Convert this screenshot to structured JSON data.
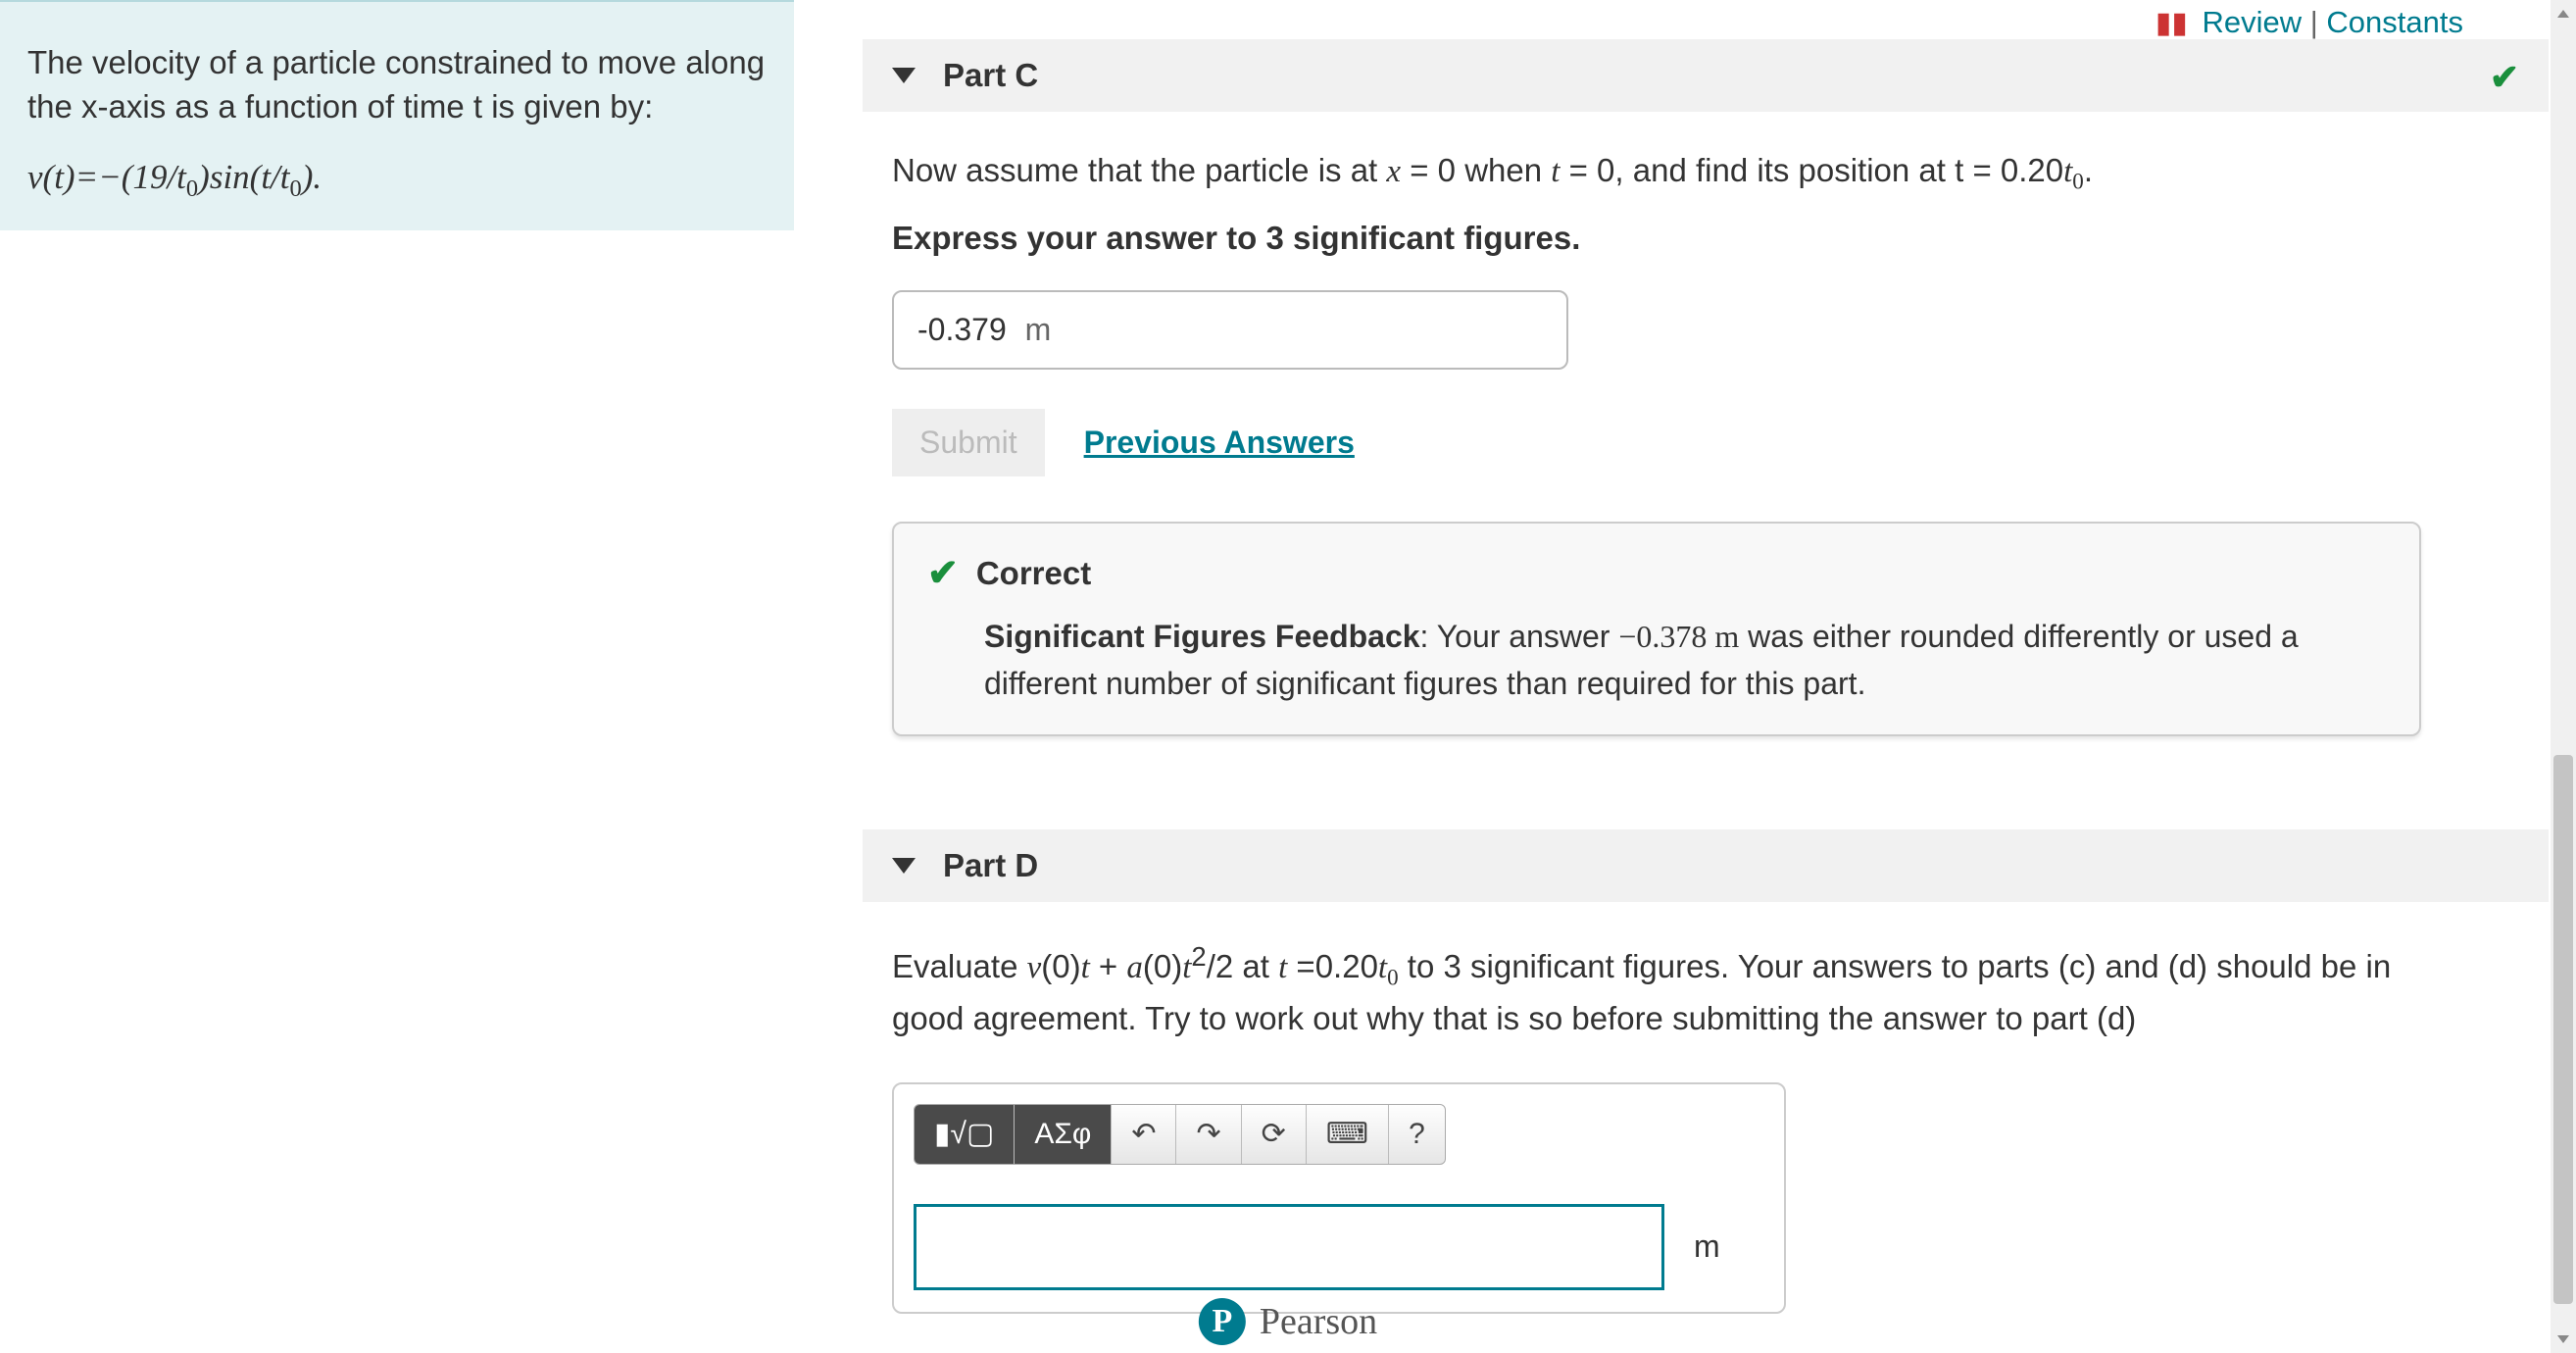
{
  "problem": {
    "intro": "The velocity of a particle constrained to move along the x-axis as a function of time t is given by:",
    "equation_html": "v(t)=−(19/t<sub class='sub'>0</sub>)sin(t/t<sub class='sub'>0</sub>)."
  },
  "toplinks": {
    "review": "Review",
    "constants": "Constants",
    "sep": " | "
  },
  "partC": {
    "title": "Part C",
    "prompt_html": "Now assume that the particle is at <span class='math'>x</span> = 0 when <span class='math'>t</span> = 0, and find its position at t = 0.20<span class='math'>t<sub class='sub'>0</sub></span>.",
    "instruct": "Express your answer to 3 significant figures.",
    "answer_value": "-0.379",
    "answer_unit": "m",
    "submit": "Submit",
    "prev": "Previous Answers",
    "feedback": {
      "status": "Correct",
      "body_html": "<span class='bold'>Significant Figures Feedback</span>: Your answer <span class='mono'>−0.378 m</span> was either rounded differently or used a different number of significant figures than required for this part."
    }
  },
  "partD": {
    "title": "Part D",
    "prompt_html": "Evaluate <span class='math'>v</span>(0)<span class='math'>t</span> + <span class='math'>a</span>(0)<span class='math'>t</span><sup>2</sup>/2 at <span class='math'>t</span> =0.20<span class='math'>t<sub class='sub'>0</sub></span> to 3 significant figures. Your answers to parts (c) and (d) should be in good agreement. Try to work out why that is so before submitting the answer to part (d)",
    "toolbar": {
      "templates": "▮√▢",
      "greek": "ΑΣφ",
      "undo": "↶",
      "redo": "↷",
      "reset": "⟳",
      "keyboard": "⌨",
      "help": "?"
    },
    "unit": "m"
  },
  "footer": {
    "brand": "Pearson",
    "logo_letter": "P"
  }
}
